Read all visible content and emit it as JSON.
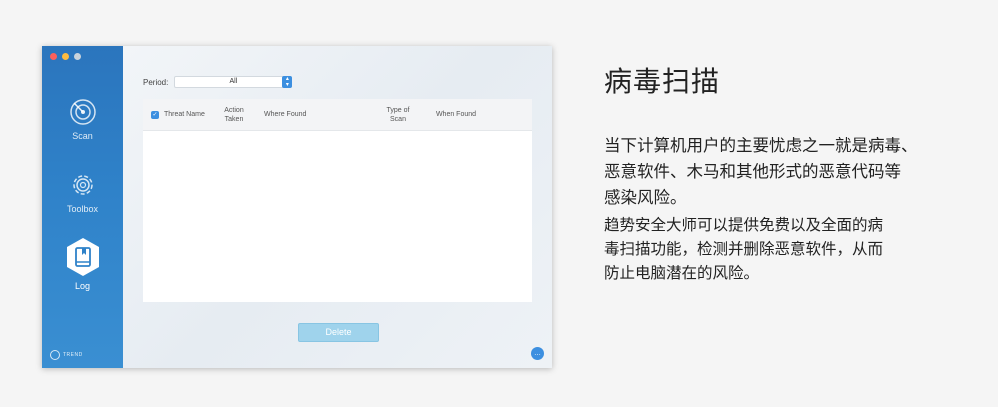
{
  "sidebar": {
    "items": [
      {
        "label": "Scan",
        "icon": "radar-icon"
      },
      {
        "label": "Toolbox",
        "icon": "gear-icon"
      },
      {
        "label": "Log",
        "icon": "book-icon",
        "active": true
      }
    ],
    "brand": "TREND"
  },
  "filter": {
    "label": "Period:",
    "value": "All"
  },
  "table": {
    "columns": [
      "Threat Name",
      "Action\nTaken",
      "Where Found",
      "Type of\nScan",
      "When Found"
    ]
  },
  "actions": {
    "delete_label": "Delete"
  },
  "heading": "病毒扫描",
  "paragraph1": [
    "当下计算机用户的主要忧虑之一就是病毒、",
    "恶意软件、木马和其他形式的恶意代码等",
    "感染风险。"
  ],
  "paragraph2": [
    "趋势安全大师可以提供免费以及全面的病",
    "毒扫描功能，检测并删除恶意软件，从而",
    "防止电脑潜在的风险。"
  ],
  "colors": {
    "sidebar": "#2f82c9",
    "accent": "#3c8fe0",
    "button": "#9fd3ec"
  }
}
